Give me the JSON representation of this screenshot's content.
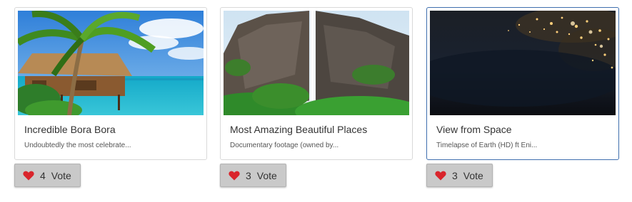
{
  "colors": {
    "heart": "#d9252c",
    "selected_border": "#3f6fae",
    "card_border": "#d9d9d9",
    "button_bg": "#c9c9c9"
  },
  "cards": [
    {
      "title": "Incredible Bora Bora",
      "description": "Undoubtedly the most celebrate...",
      "votes": "4",
      "vote_label": "Vote",
      "icon": "heart-icon"
    },
    {
      "title": "Most Amazing Beautiful Places",
      "description": "Documentary footage (owned by...",
      "votes": "3",
      "vote_label": "Vote",
      "icon": "heart-icon"
    },
    {
      "title": "View from Space",
      "description": "Timelapse of Earth (HD) ft Eni...",
      "votes": "3",
      "vote_label": "Vote",
      "icon": "heart-icon",
      "selected": true
    }
  ]
}
